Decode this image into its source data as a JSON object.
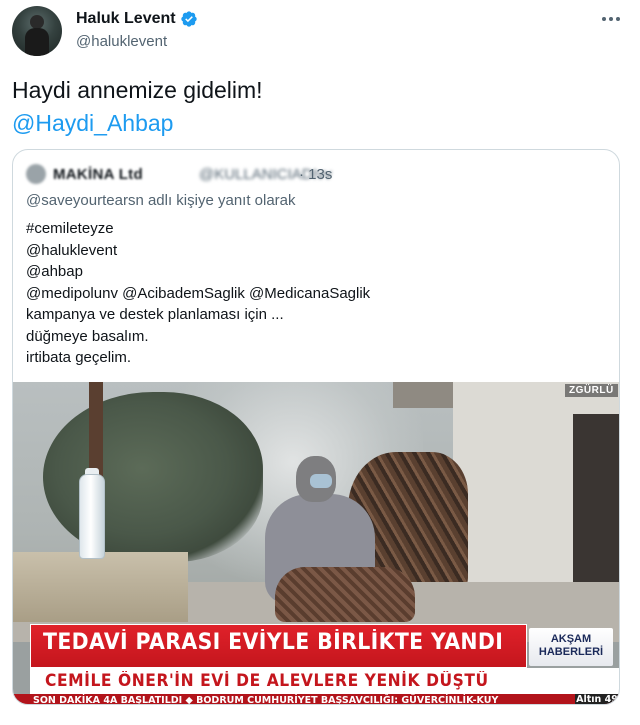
{
  "author": {
    "display_name": "Haluk Levent",
    "handle": "@haluklevent",
    "verified": true
  },
  "tweet": {
    "text_line1": "Haydi annemize gidelim!",
    "mention": "@Haydi_Ahbap"
  },
  "quoted_tweet": {
    "display_name": "MAKİNA Ltd",
    "handle": "@KULLANICIADIvv",
    "separator": "·",
    "time": "13s",
    "reply_context": "@saveyourtearsn adlı kişiye yanıt olarak",
    "lines": [
      "#cemileteyze",
      "@haluklevent",
      "@ahbap",
      "@medipolunv @AcibademSaglik @MedicanaSaglik",
      "kampanya ve destek planlaması için ...",
      "düğmeye basalım.",
      "irtibata geçelim."
    ],
    "media": {
      "channel_logo": "ZGÜRLÜ",
      "headline": "TEDAVİ PARASI EVİYLE BİRLİKTE YANDI",
      "subheadline": "CEMİLE ÖNER'İN EVİ DE ALEVLERE YENİK DÜŞTÜ",
      "program_line1": "AKŞAM",
      "program_line2": "HABERLERİ",
      "ticker": "SON DAKİKA   4A BAŞLATILDI   ◆ BODRUM CUMHURİYET BAŞSAVCILIĞI: GÜVERCİNLİK-KUY",
      "ticker_badge": "Altın 49"
    }
  },
  "colors": {
    "link": "#1d9bf0",
    "secondary_text": "#536471",
    "border": "#cfd9de",
    "banner_red": "#c4161d"
  },
  "icons": {
    "verified": "verified-badge-icon",
    "more": "more-options-icon"
  }
}
